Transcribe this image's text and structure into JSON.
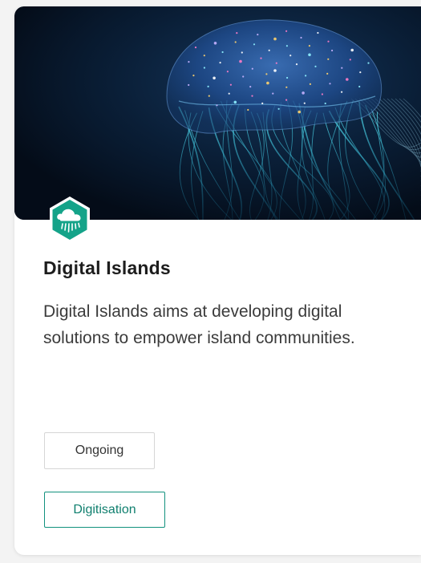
{
  "card": {
    "title": "Digital Islands",
    "description": "Digital Islands aims at developing digital solutions to empower island communities.",
    "hero_icon": "jellyfish-image",
    "badge_icon": "cloud-rain-icon",
    "status_tag": "Ongoing",
    "topic_tag": "Digitisation"
  },
  "colors": {
    "accent": "#14a389",
    "topic_border": "#12917e",
    "hero_background": "#061424"
  }
}
